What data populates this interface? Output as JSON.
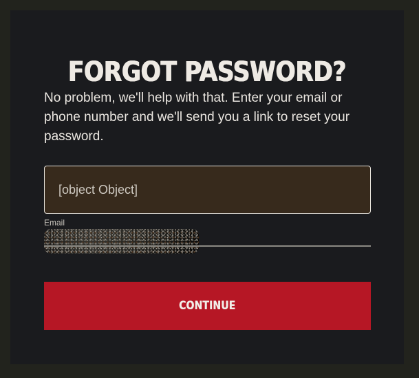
{
  "dialog": {
    "title": "FORGOT PASSWORD?",
    "description": "No problem, we'll help with that. Enter your email or phone number and we'll send you a link to reset your password.",
    "input": {
      "value": "[object Object]"
    },
    "email": {
      "label": "Email",
      "value_redacted": true
    },
    "continue_label": "CONTINUE"
  },
  "colors": {
    "background": "#22231d",
    "panel": "#1a1b1e",
    "input_fill": "#372a1c",
    "button": "#b61725",
    "text": "#ebe7e1"
  }
}
